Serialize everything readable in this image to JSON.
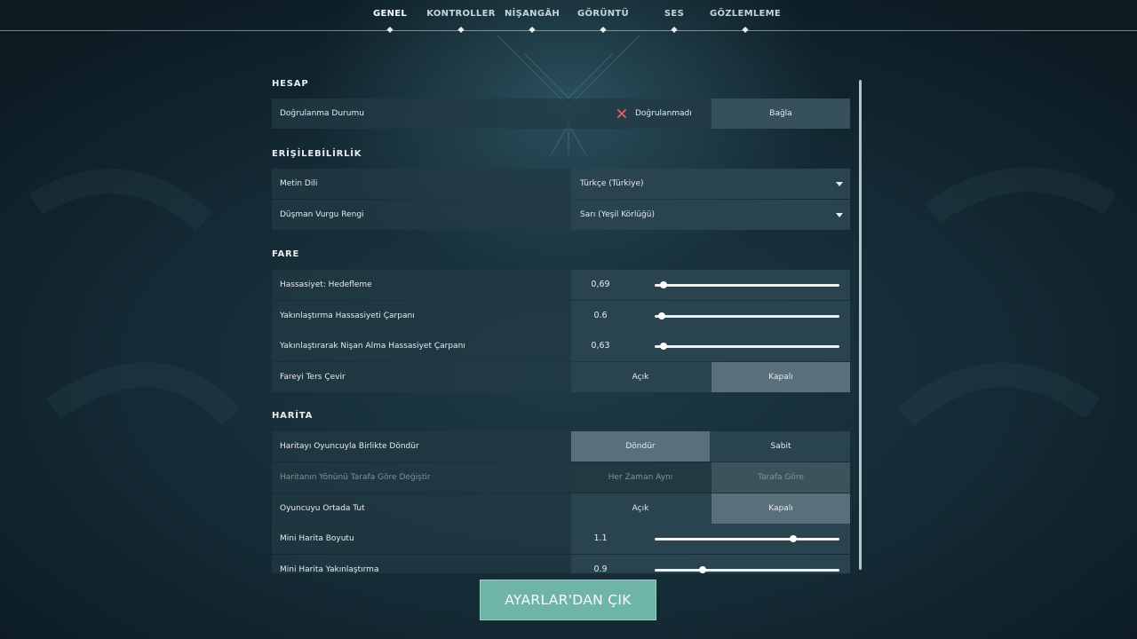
{
  "nav": {
    "tabs": [
      "GENEL",
      "KONTROLLER",
      "NİŞANGÂH",
      "GÖRÜNTÜ",
      "SES",
      "GÖZLEMLEME"
    ],
    "active_tab": "GENEL"
  },
  "sections": {
    "account": {
      "title": "HESAP",
      "verification": {
        "label": "Doğrulanma Durumu",
        "status_text": "Doğrulanmadı",
        "status_icon": "x-icon",
        "status_color": "#e0566a",
        "button": "Bağla"
      }
    },
    "accessibility": {
      "title": "ERİŞİLEBİLİRLİK",
      "text_language": {
        "label": "Metin Dili",
        "value": "Türkçe (Türkiye)"
      },
      "enemy_highlight": {
        "label": "Düşman Vurgu Rengi",
        "value": "Sarı (Yeşil Körlüğü)"
      }
    },
    "mouse": {
      "title": "FARE",
      "sensitivity": {
        "label": "Hassasiyet: Hedefleme",
        "value": "0,69",
        "fraction": 0.05
      },
      "zoom_multiplier": {
        "label": "Yakınlaştırma Hassasiyeti Çarpanı",
        "value": "0.6",
        "fraction": 0.04
      },
      "ads_multiplier": {
        "label": "Yakınlaştırarak Nişan Alma Hassasiyet Çarpanı",
        "value": "0,63",
        "fraction": 0.05
      },
      "invert": {
        "label": "Fareyi Ters Çevir",
        "options": [
          "Açık",
          "Kapalı"
        ],
        "selected": "Kapalı"
      }
    },
    "map": {
      "title": "HARİTA",
      "rotate": {
        "label": "Haritayı Oyuncuyla Birlikte Döndür",
        "options": [
          "Döndür",
          "Sabit"
        ],
        "selected": "Döndür"
      },
      "orientation": {
        "label": "Haritanın Yönünü Tarafa Göre Değiştir",
        "options": [
          "Her Zaman Aynı",
          "Tarafa Göre"
        ],
        "selected": "Tarafa Göre",
        "disabled": true
      },
      "keep_centered": {
        "label": "Oyuncuyu Ortada Tut",
        "options": [
          "Açık",
          "Kapalı"
        ],
        "selected": "Kapalı"
      },
      "minimap_size": {
        "label": "Mini Harita Boyutu",
        "value": "1.1",
        "fraction": 0.75
      },
      "minimap_zoom": {
        "label": "Mini Harita Yakınlaştırma",
        "value": "0.9",
        "fraction": 0.26
      }
    }
  },
  "exit_button": "AYARLAR'DAN ÇIK",
  "colors": {
    "accent": "#6fb5a7",
    "background": "#163039"
  }
}
